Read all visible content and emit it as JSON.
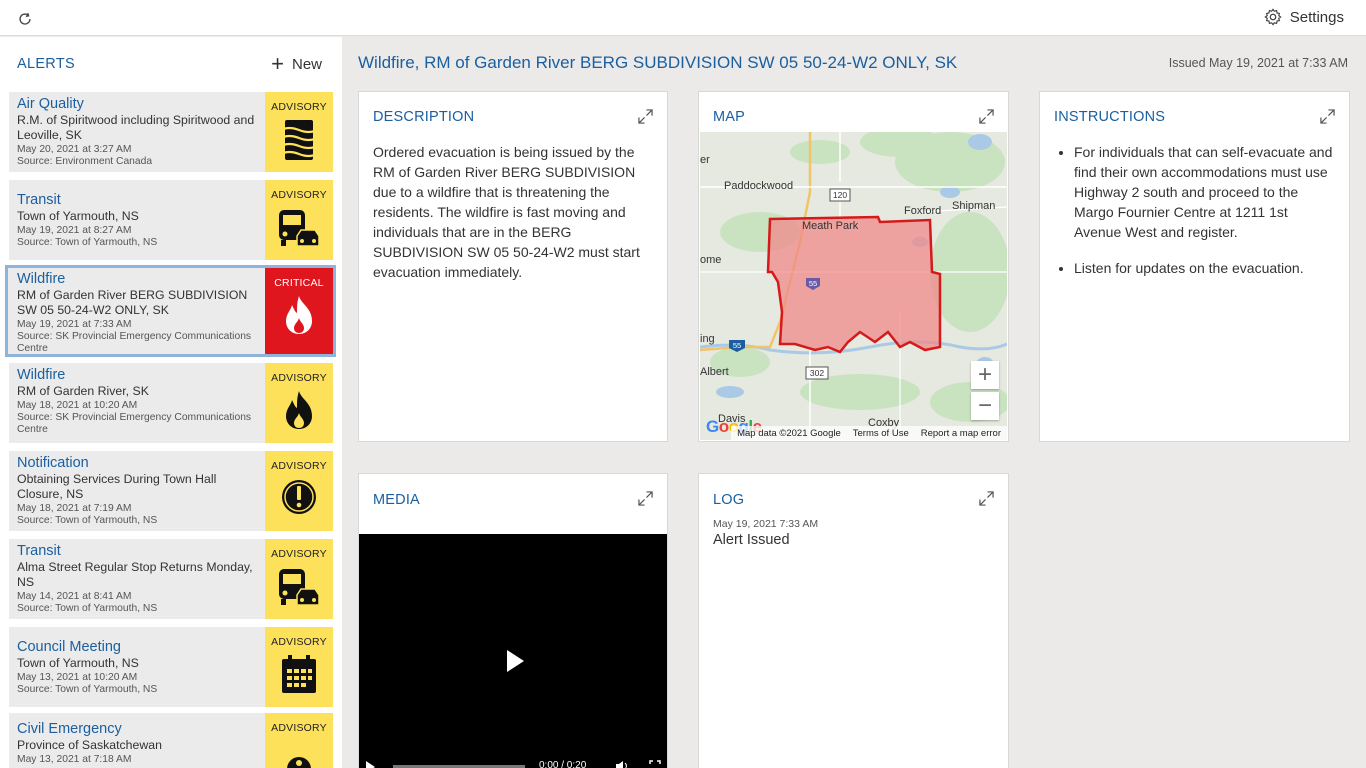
{
  "topbar": {
    "settings_label": "Settings"
  },
  "sidebar": {
    "title": "ALERTS",
    "new_label": "New",
    "alerts": [
      {
        "title": "Air Quality",
        "location": "R.M. of Spiritwood including Spiritwood and Leoville, SK",
        "date": "May 20, 2021 at 3:27 AM",
        "source": "Source: Environment Canada",
        "level": "ADVISORY",
        "icon": "haze-icon"
      },
      {
        "title": "Transit",
        "location": "Town of Yarmouth, NS",
        "date": "May 19, 2021 at 8:27 AM",
        "source": "Source: Town of Yarmouth, NS",
        "level": "ADVISORY",
        "icon": "bus-car-icon"
      },
      {
        "title": "Wildfire",
        "location": "RM of Garden River BERG SUBDIVISION SW 05 50-24-W2 ONLY, SK",
        "date": "May 19, 2021 at 7:33 AM",
        "source": "Source: SK Provincial Emergency Communications Centre",
        "level": "CRITICAL",
        "icon": "fire-icon"
      },
      {
        "title": "Wildfire",
        "location": "RM of Garden River, SK",
        "date": "May 18, 2021 at 10:20 AM",
        "source": "Source: SK Provincial Emergency Communications Centre",
        "level": "ADVISORY",
        "icon": "fire-icon"
      },
      {
        "title": "Notification",
        "location": "Obtaining Services During Town Hall Closure, NS",
        "date": "May 18, 2021 at 7:19 AM",
        "source": "Source: Town of Yarmouth, NS",
        "level": "ADVISORY",
        "icon": "exclamation-icon"
      },
      {
        "title": "Transit",
        "location": "Alma Street Regular Stop Returns Monday, NS",
        "date": "May 14, 2021 at 8:41 AM",
        "source": "Source: Town of Yarmouth, NS",
        "level": "ADVISORY",
        "icon": "bus-car-icon"
      },
      {
        "title": "Council Meeting",
        "location": "Town of Yarmouth, NS",
        "date": "May 13, 2021 at 10:20 AM",
        "source": "Source: Town of Yarmouth, NS",
        "level": "ADVISORY",
        "icon": "calendar-icon"
      },
      {
        "title": "Civil Emergency",
        "location": "Province of Saskatchewan",
        "date": "May 13, 2021 at 7:18 AM",
        "source": "",
        "level": "ADVISORY",
        "icon": "alarm-icon"
      }
    ]
  },
  "main": {
    "title": "Wildfire, RM of Garden River BERG SUBDIVISION SW 05 50-24-W2 ONLY, SK",
    "issued": "Issued May 19, 2021 at 7:33 AM",
    "description": {
      "title": "DESCRIPTION",
      "text": "Ordered evacuation is being issued by the RM of Garden River BERG SUBDIVISION due to a wildfire that is threatening the residents. The wildfire is fast moving and individuals that are in the BERG SUBDIVISION SW 05 50-24-W2 must start evacuation immediately."
    },
    "map": {
      "title": "MAP",
      "labels": [
        "Paddockwood",
        "Meath Park",
        "Foxford",
        "Shipman",
        "ome",
        "ing",
        "Albert",
        "Davis",
        "Coxby",
        "er"
      ],
      "roads": [
        "120",
        "55",
        "55",
        "302"
      ],
      "footer": [
        "Map data ©2021 Google",
        "Terms of Use",
        "Report a map error"
      ],
      "google_logo": "Google",
      "zoom_in": "+",
      "zoom_out": "−"
    },
    "instructions": {
      "title": "INSTRUCTIONS",
      "items": [
        "For individuals that can self-evacuate and find their own accommodations must use Highway 2 south and proceed to the Margo Fournier Centre at 1211 1st Avenue West and register.",
        "Listen for updates on the evacuation."
      ]
    },
    "media": {
      "title": "MEDIA",
      "time": "0:00 / 0:20"
    },
    "log": {
      "title": "LOG",
      "date": "May 19, 2021 7:33 AM",
      "text": "Alert Issued"
    }
  },
  "colors": {
    "accent": "#1b5fa0",
    "advisory": "#fde15a",
    "critical": "#e0161e"
  }
}
